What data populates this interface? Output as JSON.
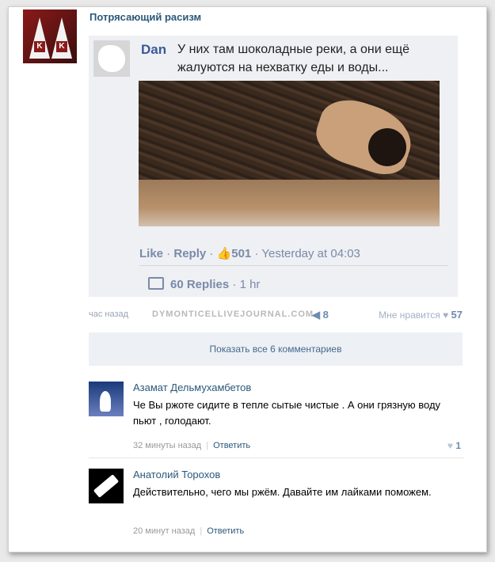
{
  "post": {
    "group_title": "Потрясающий расизм",
    "avatar_letters": [
      "K",
      "K"
    ],
    "time_ago": "час назад",
    "source_watermark": "DYMONTICELLIVEJOURNAL.COM",
    "shares": "8",
    "likes_label": "Мне нравится",
    "likes_count": "57"
  },
  "embed": {
    "author": "Dan",
    "text": "У них там шоколадные реки, а они ещё жалуются на нехватку еды и воды...",
    "like": "Like",
    "reply": "Reply",
    "like_count": "501",
    "timestamp": "Yesterday at 04:03",
    "replies_label": "60 Replies",
    "replies_time": "1 hr"
  },
  "show_all": "Показать все 6 комментариев",
  "comments": [
    {
      "author": "Азамат Дельмухамбетов",
      "text": "Че Вы ржоте сидите в тепле сытые чистые . А они грязную воду пьют , голодают.",
      "time": "32 минуты назад",
      "reply": "Ответить",
      "likes": "1"
    },
    {
      "author": "Анатолий Торохов",
      "text": "Действительно, чего мы ржём. Давайте им лайками поможем.",
      "time": "20 минут назад",
      "reply": "Ответить"
    }
  ],
  "colors": {
    "link": "#2b587a",
    "fb_blue": "#3b5998",
    "panel": "#edf0f4"
  }
}
